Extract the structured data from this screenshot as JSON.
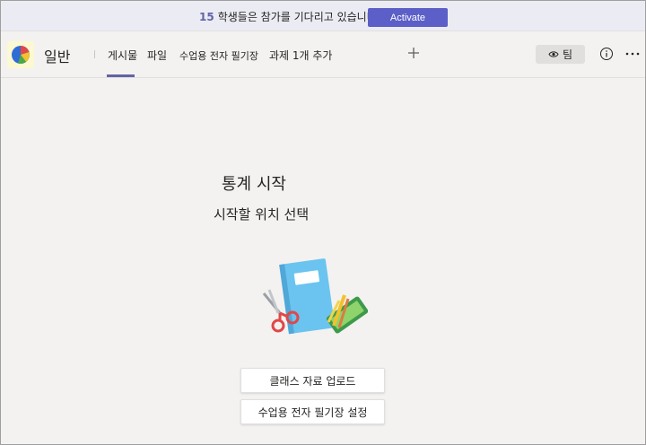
{
  "banner": {
    "count": "15",
    "message": "학생들은 참가를 기다리고 있습니다.",
    "activate_label": "Activate"
  },
  "header": {
    "channel_name": "일반",
    "tabs": [
      {
        "label": "게시물",
        "active": true
      },
      {
        "label": "파일",
        "active": false
      },
      {
        "label": "수업용 전자 필기장",
        "active": false
      },
      {
        "label": "과제 1개 추가",
        "active": false
      }
    ],
    "team_label": "팀"
  },
  "main": {
    "title": "통계 시작",
    "subtitle": "시작할 위치 선택",
    "buttons": {
      "upload": "클래스 자료 업로드",
      "notebook": "수업용 전자 필기장 설정"
    }
  },
  "colors": {
    "accent": "#6264a7",
    "activate": "#5b5fc7",
    "background": "#f3f2f1"
  }
}
